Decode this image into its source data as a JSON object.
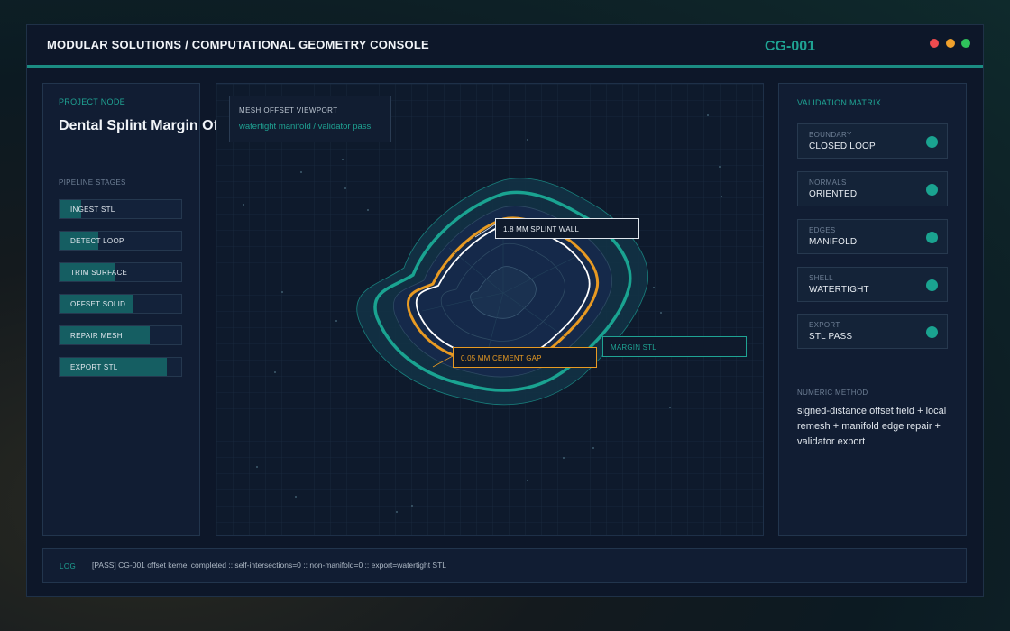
{
  "header": {
    "title": "MODULAR SOLUTIONS / COMPUTATIONAL GEOMETRY CONSOLE",
    "id": "CG-001",
    "window_controls": [
      "close",
      "minimize",
      "maximize"
    ]
  },
  "left": {
    "project_kicker": "PROJECT NODE",
    "project_title": "Dental Splint Margin Offset Engine",
    "stages_label": "PIPELINE STAGES",
    "stages": [
      {
        "label": "INGEST STL",
        "progress": 0.18
      },
      {
        "label": "DETECT LOOP",
        "progress": 0.32
      },
      {
        "label": "TRIM SURFACE",
        "progress": 0.46
      },
      {
        "label": "OFFSET SOLID",
        "progress": 0.6
      },
      {
        "label": "REPAIR MESH",
        "progress": 0.74
      },
      {
        "label": "EXPORT STL",
        "progress": 0.88
      }
    ]
  },
  "viewport": {
    "title": "MESH OFFSET VIEWPORT",
    "subtitle": "watertight manifold / validator pass",
    "callouts": {
      "wall": "1.8 MM SPLINT WALL",
      "gap": "0.05 MM CEMENT GAP",
      "margin": "MARGIN STL"
    }
  },
  "right": {
    "title": "VALIDATION MATRIX",
    "checks": [
      {
        "category": "BOUNDARY",
        "value": "CLOSED LOOP",
        "status": "pass"
      },
      {
        "category": "NORMALS",
        "value": "ORIENTED",
        "status": "pass"
      },
      {
        "category": "EDGES",
        "value": "MANIFOLD",
        "status": "pass"
      },
      {
        "category": "SHELL",
        "value": "WATERTIGHT",
        "status": "pass"
      },
      {
        "category": "EXPORT",
        "value": "STL PASS",
        "status": "pass"
      }
    ],
    "method_label": "NUMERIC METHOD",
    "method_text": "signed-distance offset field + local remesh + manifold edge repair + validator export"
  },
  "log": {
    "label": "LOG",
    "message": "[PASS] CG-001 offset kernel completed :: self-intersections=0 :: non-manifold=0 :: export=watertight STL"
  },
  "colors": {
    "accent": "#1fa393",
    "wall": "#ffffff",
    "gap": "#e89a22",
    "background": "#0d1729"
  }
}
